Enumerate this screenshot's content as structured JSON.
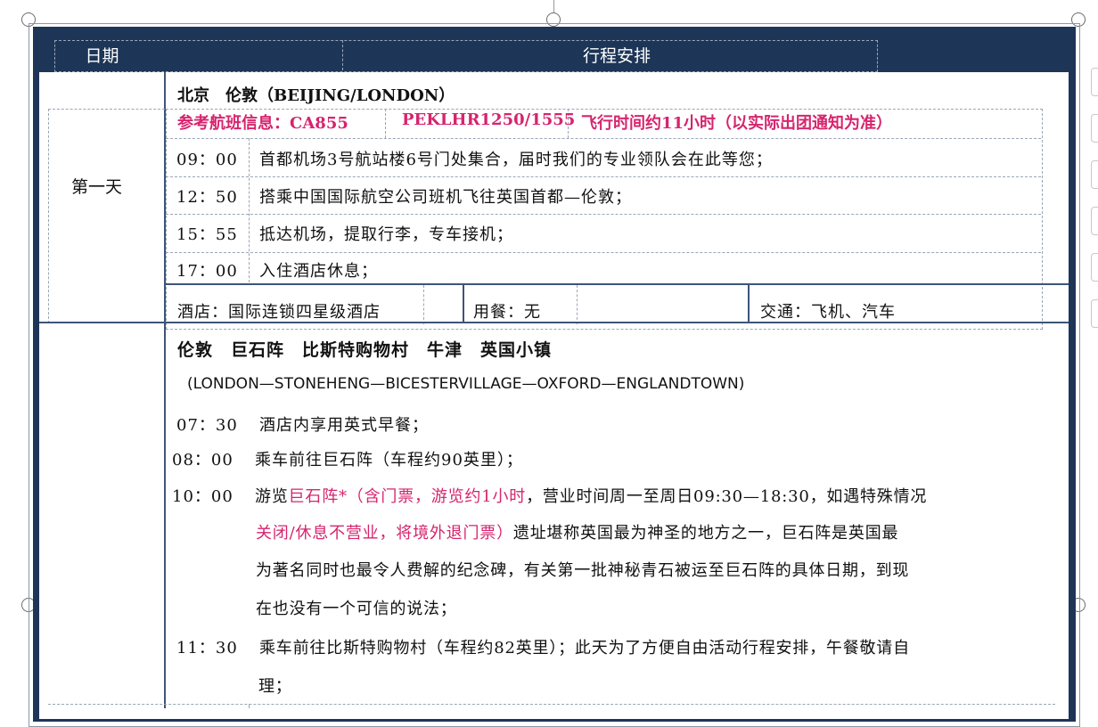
{
  "header": {
    "date": "日期",
    "plan": "行程安排"
  },
  "day1": {
    "label": "第一天",
    "route": "北京　伦敦（BEIJING/LONDON）",
    "flight": {
      "prefix": "参考航班信息：CA855",
      "code": "PEKLHR1250/1555",
      "duration": "飞行时间约11小时（以实际出团通知为准）"
    },
    "items": [
      {
        "time": "09：00",
        "text": "首都机场3号航站楼6号门处集合，届时我们的专业领队会在此等您；"
      },
      {
        "time": "12：50",
        "text": "搭乘中国国际航空公司班机飞往英国首都—伦敦；"
      },
      {
        "time": "15：55",
        "text": "抵达机场，提取行李，专车接机；"
      },
      {
        "time": "17：00",
        "text": "入住酒店休息；"
      }
    ],
    "hotel": "酒店：国际连锁四星级酒店",
    "meals": "用餐：无",
    "transport": "交通：飞机、汽车"
  },
  "day2": {
    "route": "伦敦　巨石阵　比斯特购物村　牛津　英国小镇",
    "route_en": "(LONDON—STONEHENG—BICESTERVILLAGE—OXFORD—ENGLANDTOWN)",
    "items": [
      {
        "time": "07：30",
        "text": "酒店内享用英式早餐；"
      },
      {
        "time": "08：00",
        "text": "乘车前往巨石阵（车程约90英里）；"
      }
    ],
    "stone": {
      "time": "10：00",
      "prefix": "游览",
      "pink1": "巨石阵*（含门票，游览约1小时",
      "mid": "，营业时间周一至周日09:30—18:30，如遇特殊情况",
      "line2_a": "关闭/休息不营业，将境外退门票",
      "line2_b": "）",
      "line2_c": "遗址堪称英国最为神圣的地方之一，巨石阵是英国最",
      "line3": "为著名同时也最令人费解的纪念碑，有关第一批神秘青石被运至巨石阵的具体日期，到现",
      "line4": "在也没有一个可信的说法；"
    },
    "bicester": {
      "time": "11：30",
      "line1": "乘车前往比斯特购物村（车程约82英里）；此天为了方便自由活动行程安排，午餐敬请自",
      "line2": "理；"
    }
  }
}
